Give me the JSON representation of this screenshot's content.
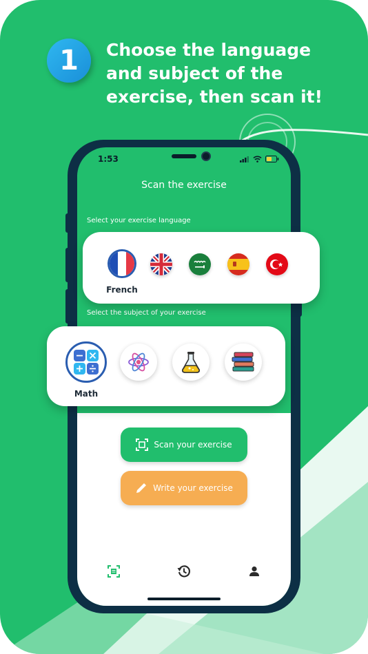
{
  "step": {
    "number": "1"
  },
  "headline": {
    "line1": "Choose the language",
    "line2": "and subject of the",
    "line3": "exercise, then scan it!"
  },
  "status_bar": {
    "time": "1:53"
  },
  "screen": {
    "title": "Scan the exercise",
    "language_label": "Select your exercise language",
    "subject_label": "Select the subject of your exercise"
  },
  "languages": {
    "selected": "French",
    "items": [
      "french-flag",
      "uk-flag",
      "saudi-arabia-flag",
      "spain-flag",
      "turkey-flag"
    ]
  },
  "subjects": {
    "selected": "Math",
    "items": [
      "math-icon",
      "atom-icon",
      "flask-icon",
      "books-icon"
    ]
  },
  "buttons": {
    "scan": "Scan your exercise",
    "write": "Write your exercise"
  },
  "tabbar": {
    "items": [
      "scan-tab-icon",
      "history-icon",
      "profile-icon"
    ]
  },
  "colors": {
    "brand_green": "#21be6d",
    "write_orange": "#f6ad52",
    "badge_blue": "#1a8fd8",
    "phone_frame": "#0d2f45"
  }
}
